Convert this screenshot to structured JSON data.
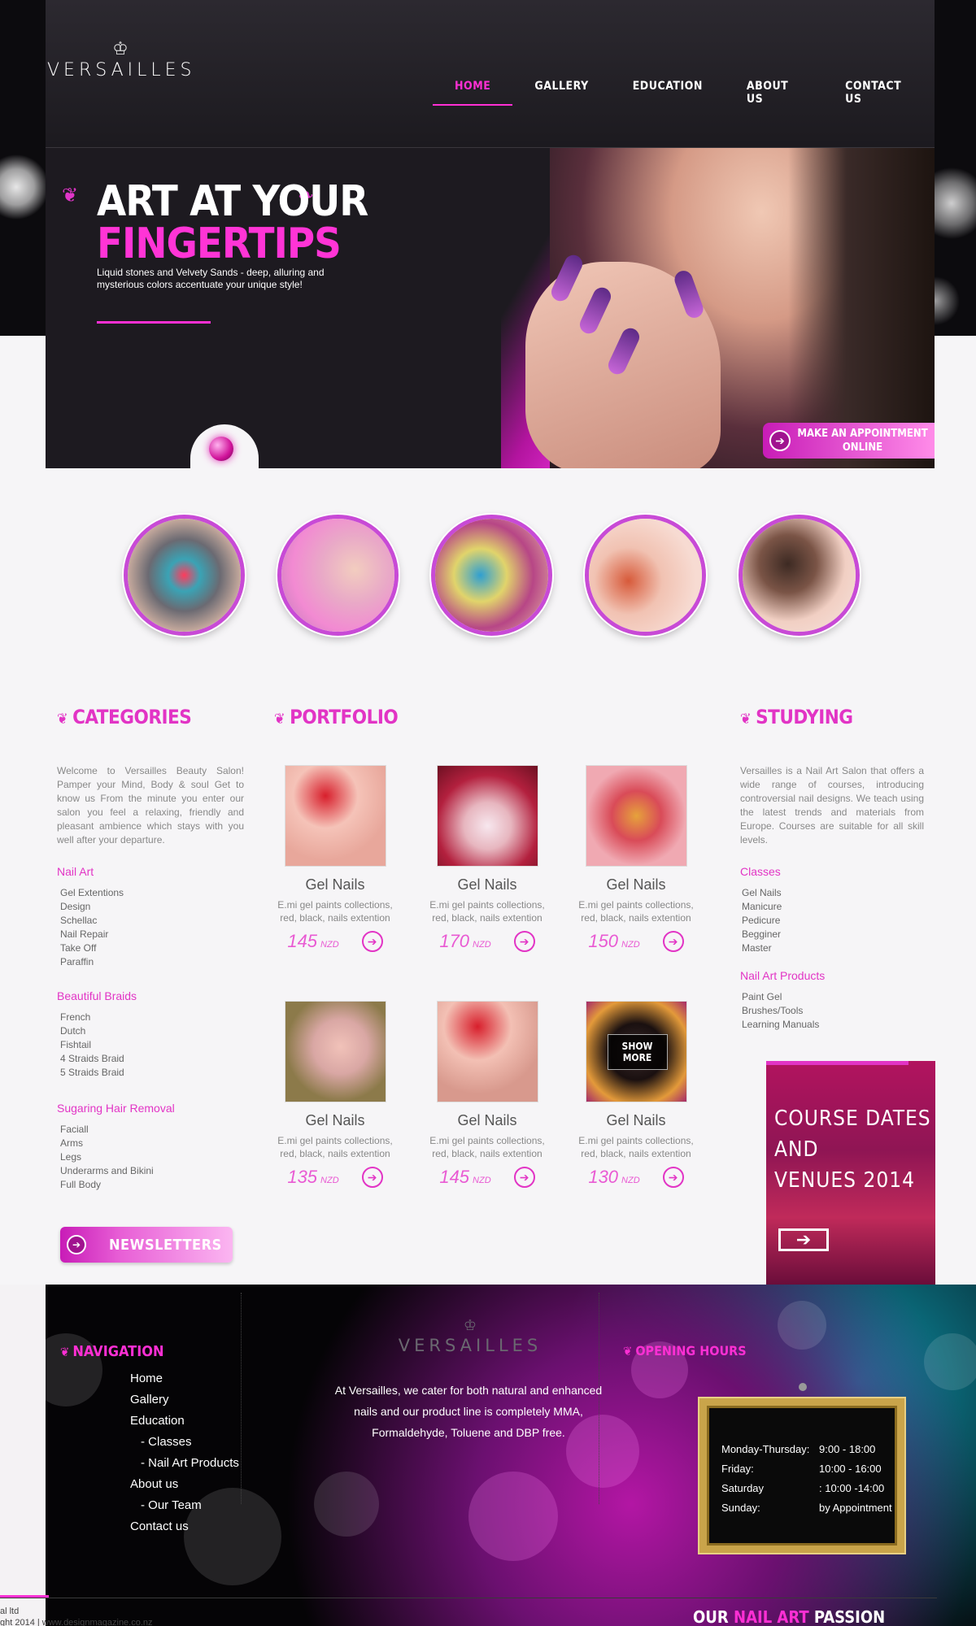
{
  "brand": {
    "name": "VERSAILLES",
    "crown_icon": "crown-icon"
  },
  "nav": [
    {
      "label": "HOME",
      "active": true
    },
    {
      "label": "GALLERY",
      "active": false
    },
    {
      "label": "EDUCATION",
      "active": false
    },
    {
      "label": "ABOUT US",
      "active": false
    },
    {
      "label": "CONTACT US",
      "active": false
    }
  ],
  "hero": {
    "line1": "ART AT YOUR",
    "line2": "FINGERTIPS",
    "subtitle": "Liquid stones and Velvety Sands - deep, alluring and mysterious colors accentuate your unique style!",
    "appointment_label": "MAKE AN APPOINTMENT ONLINE"
  },
  "categories": {
    "title": "CATEGORIES",
    "intro": "Welcome to Versailles Beauty Salon! Pamper your Mind, Body & soul Get to know us From the minute you enter our salon you feel a relaxing, friendly and pleasant ambience which stays with you well after your departure.",
    "groups": [
      {
        "title": "Nail Art",
        "items": [
          "Gel Extentions",
          "Design",
          "Schellac",
          "Nail Repair",
          "Take Off",
          "Paraffin"
        ]
      },
      {
        "title": "Beautiful Braids",
        "items": [
          "French",
          "Dutch",
          "Fishtail",
          "4 Straids Braid",
          "5 Straids Braid"
        ]
      },
      {
        "title": "Sugaring Hair Removal",
        "items": [
          "Faciall",
          "Arms",
          "Legs",
          "Underarms and Bikini",
          "Full Body"
        ]
      }
    ],
    "newsletter_label": "NEWSLETTERS"
  },
  "portfolio": {
    "title": "PORTFOLIO",
    "currency": "NZD",
    "show_more_label": "SHOW MORE",
    "items": [
      {
        "title": "Gel Nails",
        "desc": "E.mi gel paints collections, red, black, nails extention",
        "price": "145"
      },
      {
        "title": "Gel Nails",
        "desc": "E.mi gel paints collections, red, black, nails extention",
        "price": "170"
      },
      {
        "title": "Gel Nails",
        "desc": "E.mi gel paints collections, red, black, nails extention",
        "price": "150"
      },
      {
        "title": "Gel Nails",
        "desc": "E.mi gel paints collections, red, black, nails extention",
        "price": "135"
      },
      {
        "title": "Gel Nails",
        "desc": "E.mi gel paints collections, red, black, nails extention",
        "price": "145"
      },
      {
        "title": "Gel Nails",
        "desc": "E.mi gel paints collections, red, black, nails extention",
        "price": "130"
      }
    ]
  },
  "studying": {
    "title": "STUDYING",
    "intro": "Versailles is a Nail Art Salon that offers a wide range of courses, introducing controversial nail designs. We teach using the latest trends and materials from Europe. Courses are suitable for all skill levels.",
    "groups": [
      {
        "title": "Classes",
        "items": [
          "Gel Nails",
          "Manicure",
          "Pedicure",
          "Begginer",
          "Master"
        ]
      },
      {
        "title": "Nail Art Products",
        "items": [
          "Paint Gel",
          "Brushes/Tools",
          "Learning Manuals"
        ]
      }
    ],
    "course_line1": "COURSE DATES",
    "course_line2": "AND",
    "course_line3": "VENUES 2014"
  },
  "footer": {
    "nav_title": "NAVIGATION",
    "nav_items": [
      "Home",
      "Gallery",
      "Education",
      "- Classes",
      "- Nail Art Products",
      "About us",
      "- Our Team",
      "Contact us"
    ],
    "about_text": "At Versailles, we cater for both natural and enhanced nails and our product line is completely MMA, Formaldehyde, Toluene and DBP free.",
    "hours_title": "OPENING HOURS",
    "hours": [
      {
        "day": "Monday-Thursday:",
        "time": "9:00 - 18:00"
      },
      {
        "day": "Friday:",
        "time": "10:00 - 16:00"
      },
      {
        "day": "Saturday",
        "time": ": 10:00 -14:00"
      },
      {
        "day": "Sunday:",
        "time": "by Appointment"
      }
    ],
    "tagline_pre": "OUR",
    "tagline_pink": "NAIL ART",
    "tagline_post": "PASSION",
    "copyright_line1": "al ltd",
    "copyright_line2": "ght 2014 | www.designmagazine.co.nz"
  },
  "colors": {
    "accent": "#ff2fd4",
    "dark": "#1d1a20",
    "ring": "#c84ad6"
  }
}
